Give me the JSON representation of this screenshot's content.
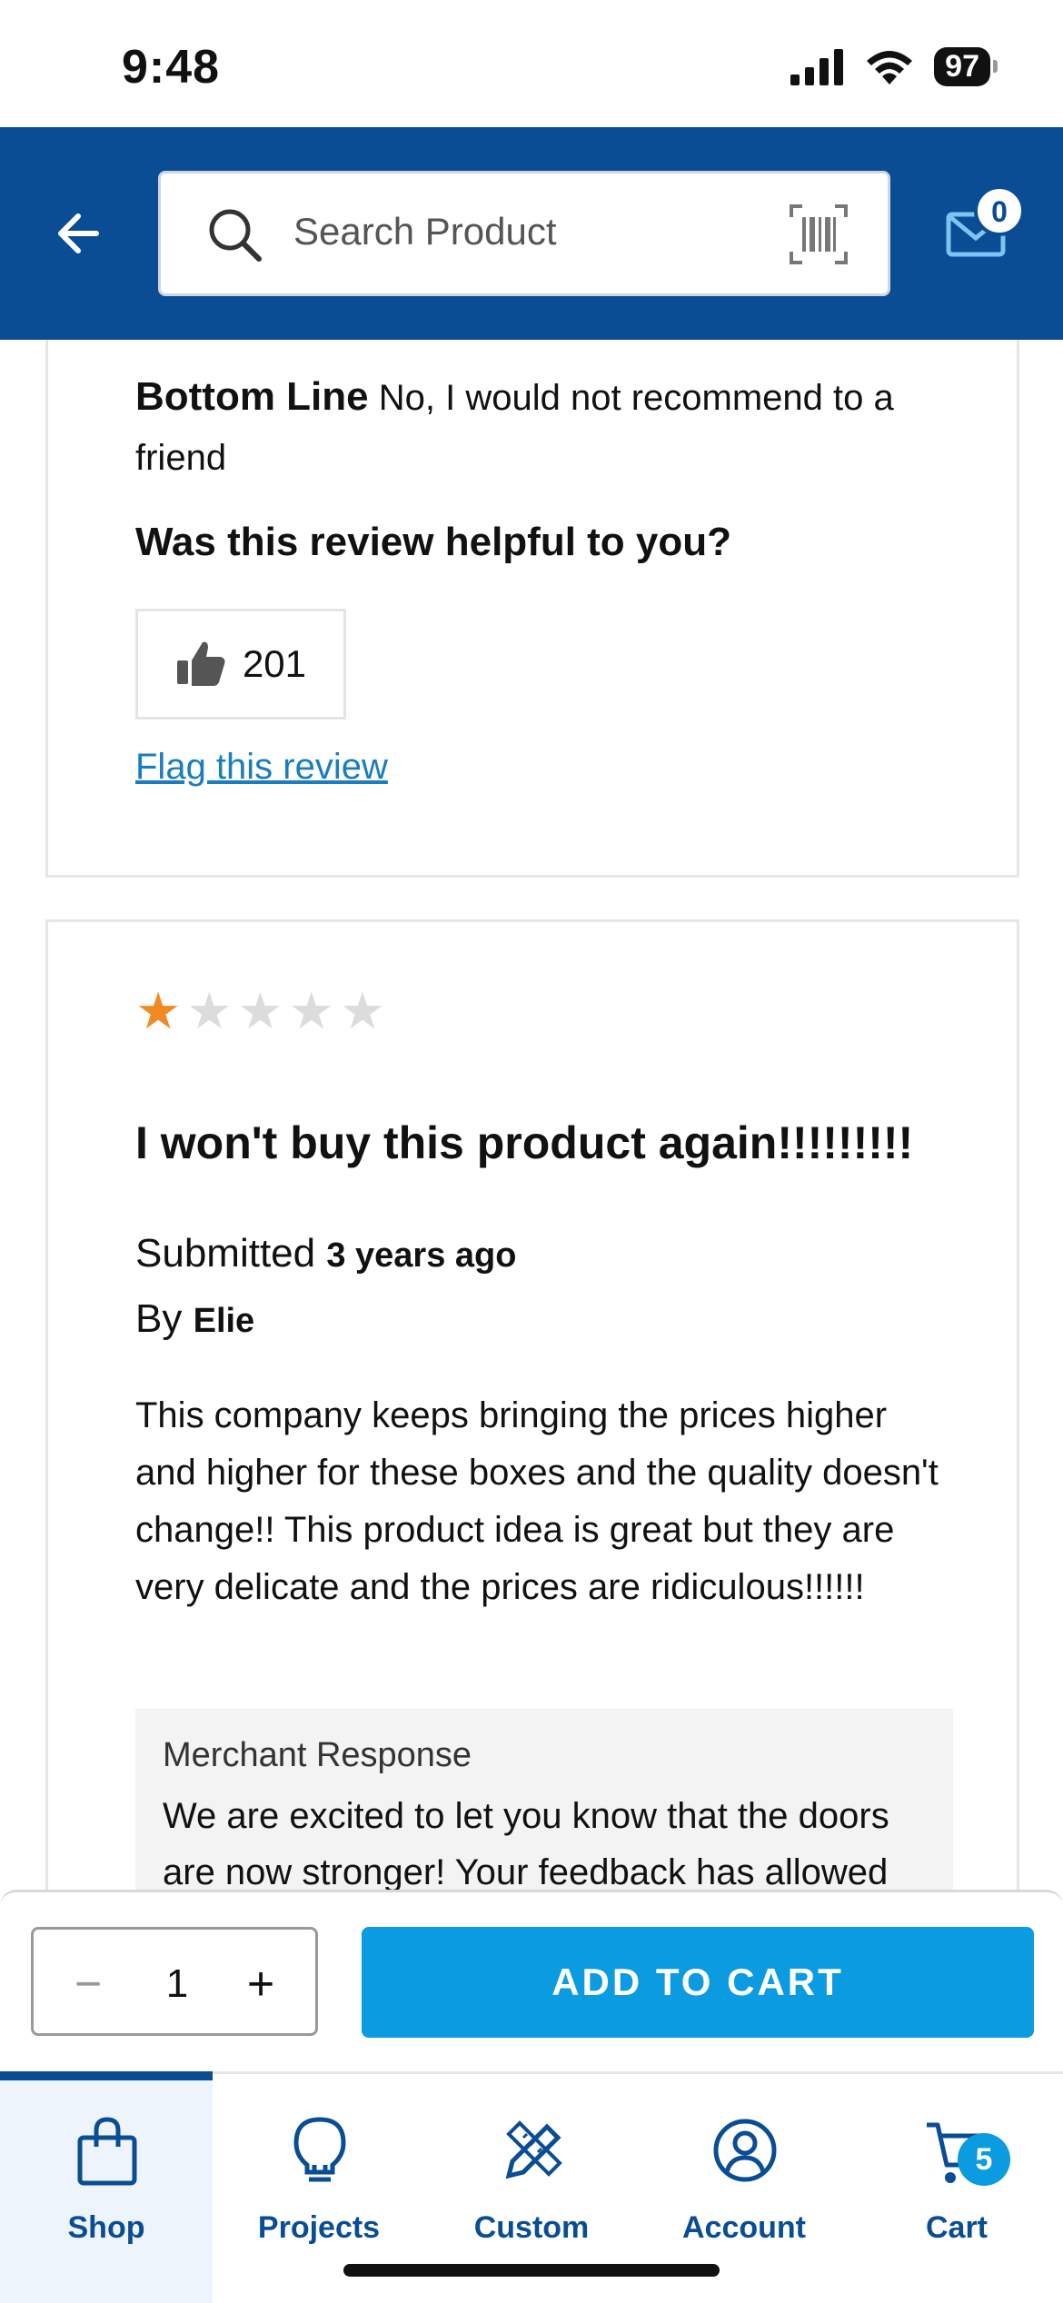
{
  "status_bar": {
    "time": "9:48",
    "battery": "97"
  },
  "header": {
    "search_placeholder": "Search Product",
    "mail_count": "0",
    "brand_color": "#0a4d94"
  },
  "review_prev": {
    "bottom_line_label": "Bottom Line",
    "bottom_line_text": "No, I would not recommend to a friend",
    "helpful_question": "Was this review helpful to you?",
    "helpful_count": "201",
    "flag_label": "Flag this review"
  },
  "review": {
    "rating": 1,
    "rating_max": 5,
    "title": "I won't buy this product again!!!!!!!!!",
    "submitted_label": "Submitted",
    "submitted_value": "3 years ago",
    "by_label": "By",
    "author": "Elie",
    "body": "This company keeps bringing the prices higher and higher for these boxes and the quality doesn't change!! This product idea is great but they are very delicate and the prices are ridiculous!!!!!!",
    "merchant_response_label": "Merchant Response",
    "merchant_response_text": "We are excited to let you know that the doors are now stronger! Your feedback has allowed"
  },
  "cart_bar": {
    "quantity": "1",
    "minus": "−",
    "plus": "+",
    "add_label": "ADD TO CART",
    "accent_color": "#0a9be0"
  },
  "tabs": [
    {
      "label": "Shop",
      "icon": "shopping-bag-icon",
      "active": true
    },
    {
      "label": "Projects",
      "icon": "lightbulb-icon",
      "active": false
    },
    {
      "label": "Custom",
      "icon": "pencil-ruler-icon",
      "active": false
    },
    {
      "label": "Account",
      "icon": "user-circle-icon",
      "active": false
    },
    {
      "label": "Cart",
      "icon": "cart-icon",
      "active": false,
      "badge": "5"
    }
  ]
}
